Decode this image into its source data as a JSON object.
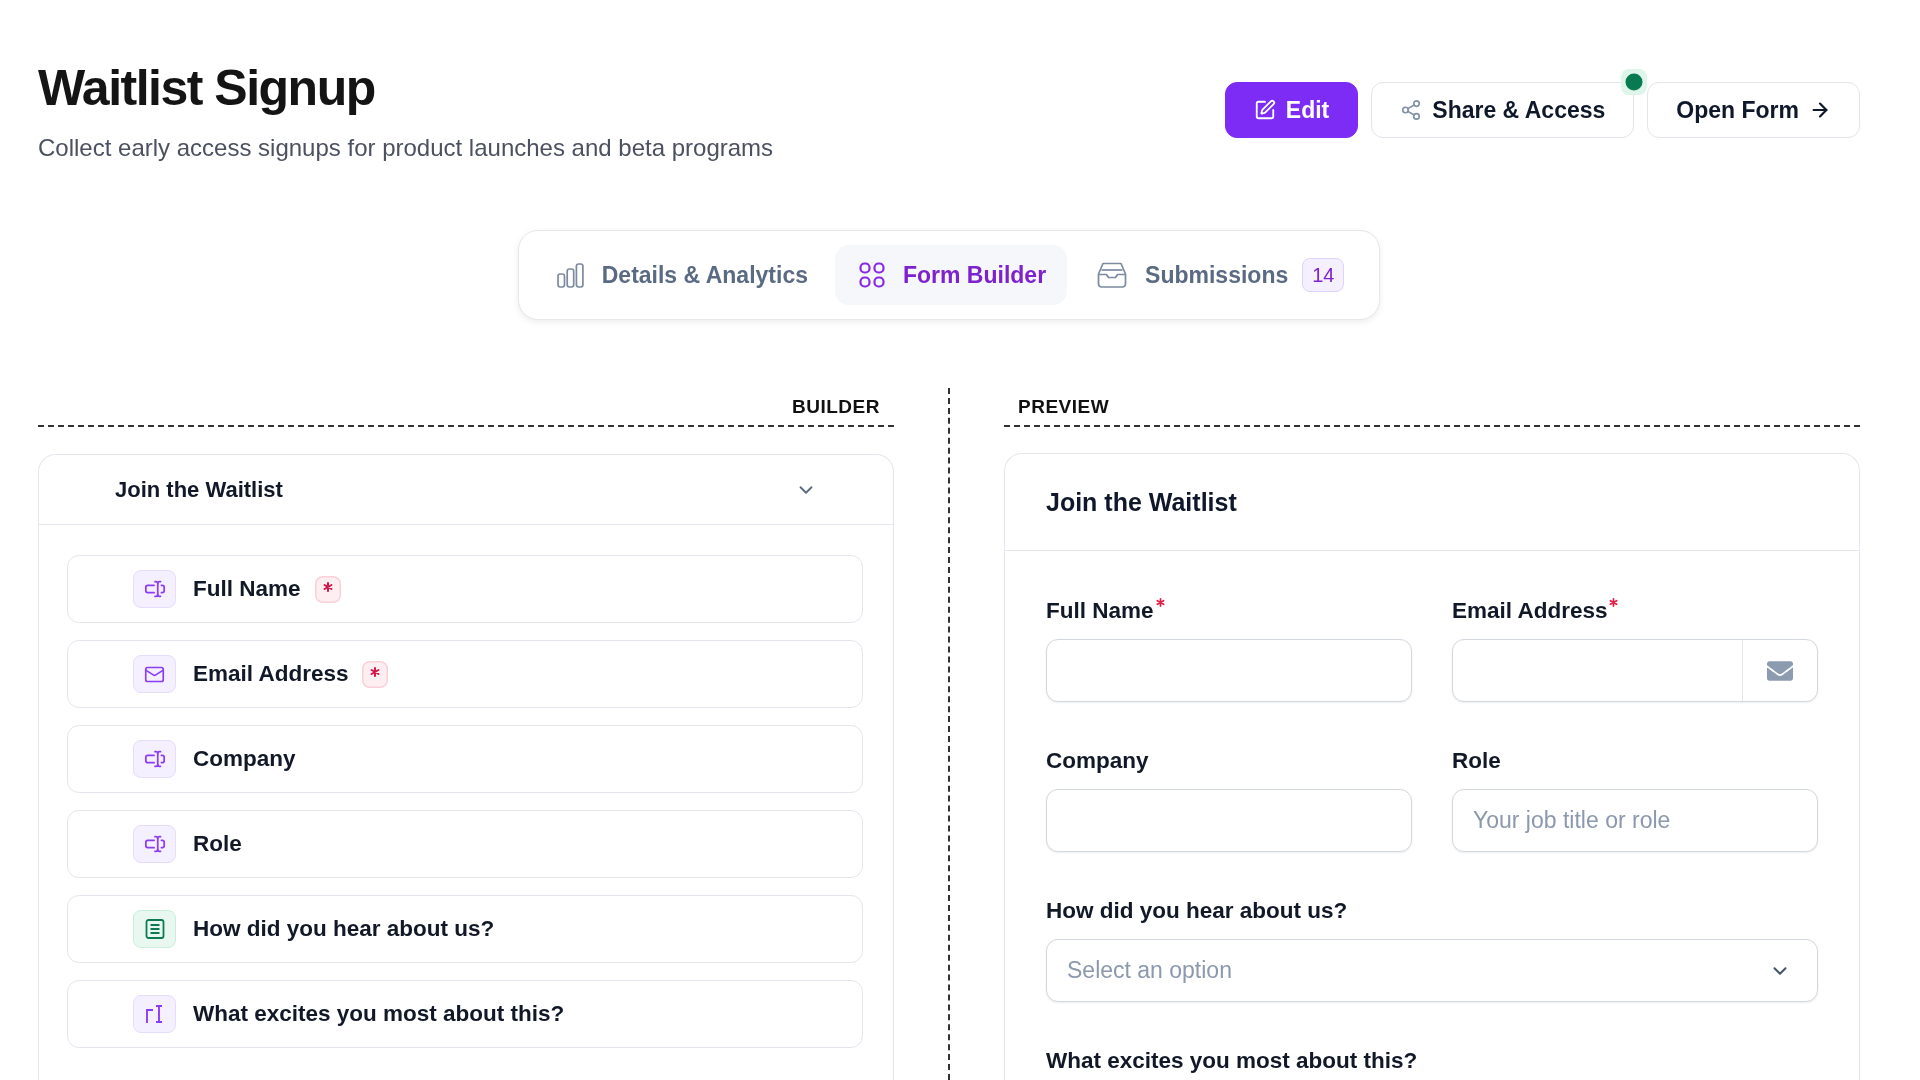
{
  "page": {
    "title": "Waitlist Signup",
    "subtitle": "Collect early access signups for product launches and beta programs"
  },
  "actions": [
    {
      "kind": "edit",
      "label": "Edit",
      "primary": true,
      "indicator": false
    },
    {
      "kind": "share",
      "label": "Share & Access",
      "primary": false,
      "indicator": true
    },
    {
      "kind": "open",
      "label": "Open Form",
      "primary": false,
      "indicator": false
    }
  ],
  "tabs": [
    {
      "kind": "analytics",
      "label": "Details & Analytics",
      "selected": false
    },
    {
      "kind": "builder",
      "label": "Form Builder",
      "selected": true
    },
    {
      "kind": "submissions",
      "label": "Submissions",
      "selected": false,
      "count": "14"
    }
  ],
  "builder": {
    "heading": "BUILDER",
    "section": {
      "title": "Join the Waitlist",
      "expanded": true
    },
    "fields": [
      {
        "label": "Full Name",
        "kind": "text",
        "required": true
      },
      {
        "label": "Email Address",
        "kind": "email",
        "required": true
      },
      {
        "label": "Company",
        "kind": "text",
        "required": false
      },
      {
        "label": "Role",
        "kind": "text",
        "required": false
      },
      {
        "label": "How did you hear about us?",
        "kind": "select",
        "required": false
      },
      {
        "label": "What excites you most about this?",
        "kind": "textarea",
        "required": false
      }
    ]
  },
  "preview": {
    "heading": "PREVIEW",
    "title": "Join the Waitlist",
    "fields": [
      {
        "label": "Full Name",
        "kind": "text",
        "required": true
      },
      {
        "label": "Email Address",
        "kind": "email",
        "required": true
      },
      {
        "label": "Company",
        "kind": "text",
        "required": false
      },
      {
        "label": "Role",
        "kind": "text",
        "required": false,
        "placeholder": "Your job title or role"
      },
      {
        "label": "How did you hear about us?",
        "kind": "select",
        "required": false,
        "placeholder": "Select an option"
      },
      {
        "label": "What excites you most about this?",
        "kind": "textarea",
        "required": false
      }
    ]
  }
}
